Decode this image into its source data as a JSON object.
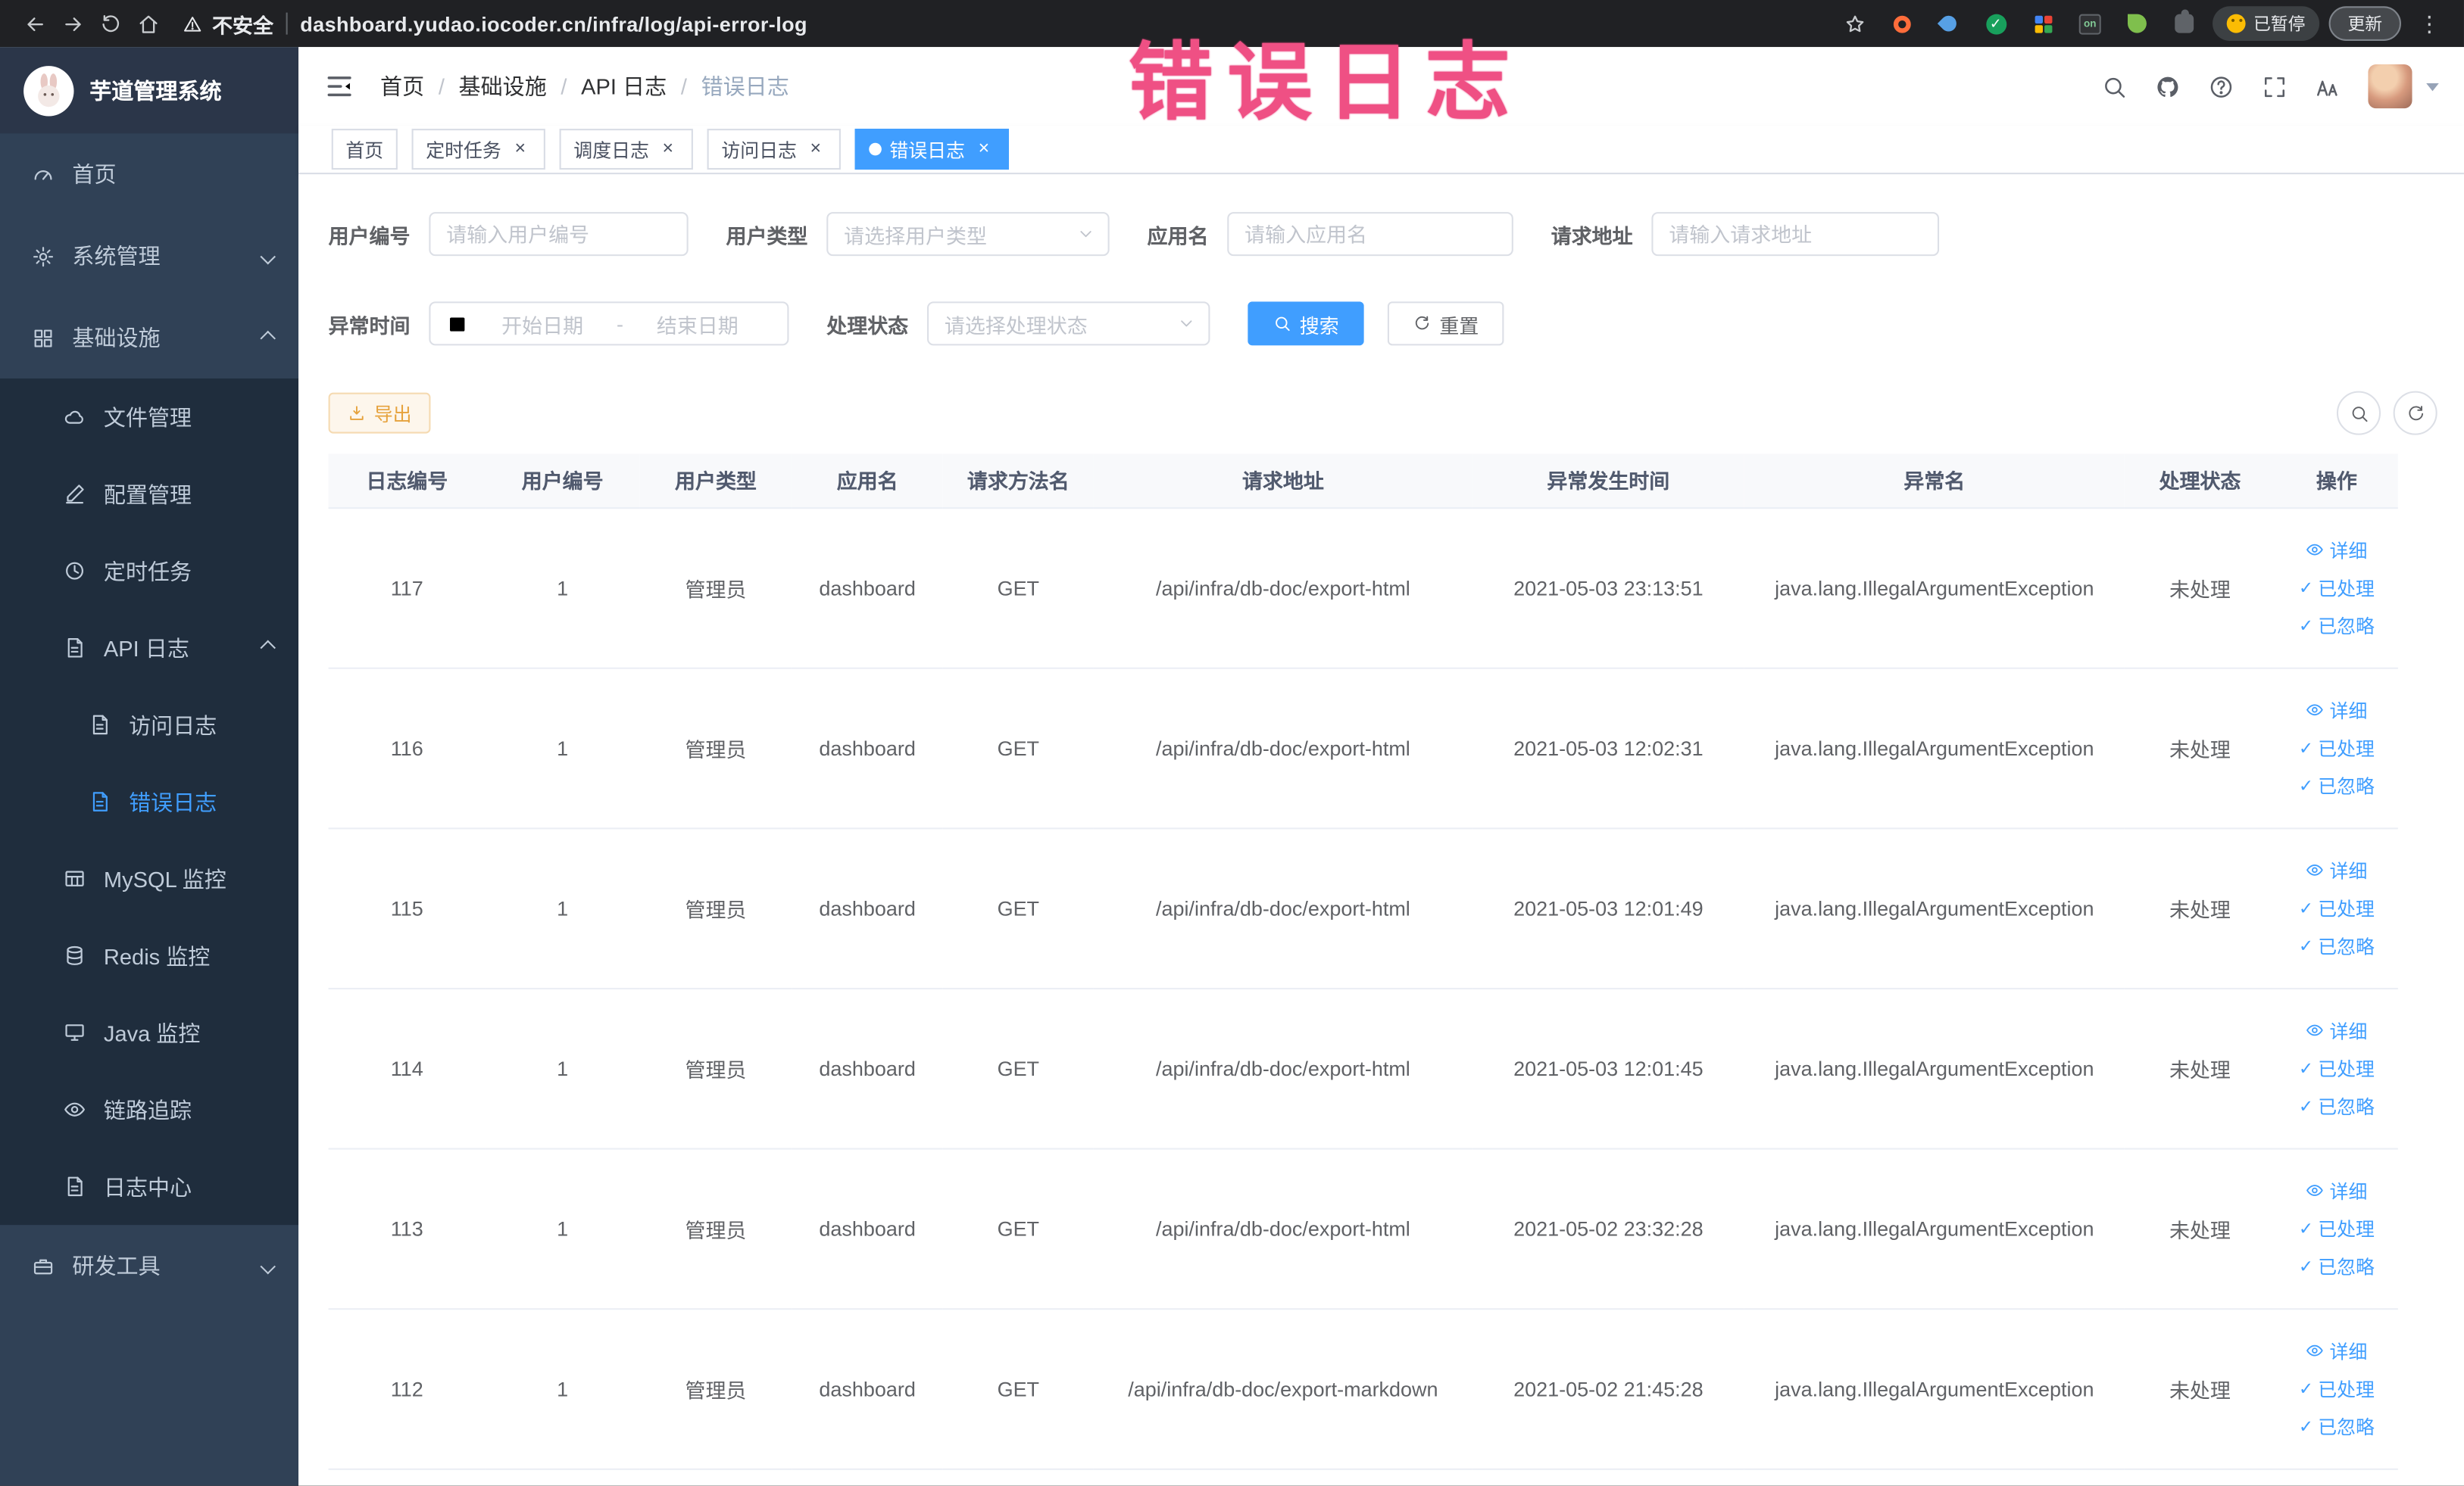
{
  "browser": {
    "security_label": "不安全",
    "url": "dashboard.yudao.iocoder.cn/infra/log/api-error-log",
    "paused_badge": "已暂停",
    "update_button": "更新"
  },
  "annotation": "错误日志",
  "sidebar": {
    "title": "芋道管理系统",
    "items": [
      {
        "label": "首页",
        "icon": "gauge-icon",
        "level": 1
      },
      {
        "label": "系统管理",
        "icon": "gear-icon",
        "level": 1,
        "expandable": true
      },
      {
        "label": "基础设施",
        "icon": "grid-icon",
        "level": 1,
        "expanded": true
      },
      {
        "label": "文件管理",
        "icon": "cloud-icon",
        "level": 2
      },
      {
        "label": "配置管理",
        "icon": "pencil-icon",
        "level": 2
      },
      {
        "label": "定时任务",
        "icon": "clock-icon",
        "level": 2
      },
      {
        "label": "API 日志",
        "icon": "doc-icon",
        "level": 2,
        "expanded": true
      },
      {
        "label": "访问日志",
        "icon": "doc-icon",
        "level": 3
      },
      {
        "label": "错误日志",
        "icon": "doc-icon",
        "level": 3,
        "active": true
      },
      {
        "label": "MySQL 监控",
        "icon": "table-icon",
        "level": 2
      },
      {
        "label": "Redis 监控",
        "icon": "database-icon",
        "level": 2
      },
      {
        "label": "Java 监控",
        "icon": "monitor-icon",
        "level": 2
      },
      {
        "label": "链路追踪",
        "icon": "eye-icon",
        "level": 2
      },
      {
        "label": "日志中心",
        "icon": "doc-icon",
        "level": 2
      },
      {
        "label": "研发工具",
        "icon": "toolbox-icon",
        "level": 1,
        "expandable": true
      }
    ]
  },
  "breadcrumb": [
    "首页",
    "基础设施",
    "API 日志",
    "错误日志"
  ],
  "tabs": [
    {
      "label": "首页",
      "closable": false,
      "active": false
    },
    {
      "label": "定时任务",
      "closable": true,
      "active": false
    },
    {
      "label": "调度日志",
      "closable": true,
      "active": false
    },
    {
      "label": "访问日志",
      "closable": true,
      "active": false
    },
    {
      "label": "错误日志",
      "closable": true,
      "active": true
    }
  ],
  "filters": {
    "user_id": {
      "label": "用户编号",
      "placeholder": "请输入用户编号"
    },
    "user_type": {
      "label": "用户类型",
      "placeholder": "请选择用户类型"
    },
    "app_name": {
      "label": "应用名",
      "placeholder": "请输入应用名"
    },
    "request_url": {
      "label": "请求地址",
      "placeholder": "请输入请求地址"
    },
    "exception_time": {
      "label": "异常时间",
      "start_placeholder": "开始日期",
      "separator": "-",
      "end_placeholder": "结束日期"
    },
    "process_status": {
      "label": "处理状态",
      "placeholder": "请选择处理状态"
    },
    "search_button": "搜索",
    "reset_button": "重置"
  },
  "toolbar": {
    "export_button": "导出"
  },
  "table": {
    "columns": [
      "日志编号",
      "用户编号",
      "用户类型",
      "应用名",
      "请求方法名",
      "请求地址",
      "异常发生时间",
      "异常名",
      "处理状态",
      "操作"
    ],
    "actions": {
      "detail": "详细",
      "processed": "已处理",
      "ignored": "已忽略"
    },
    "rows": [
      {
        "id": "117",
        "user_id": "1",
        "user_type": "管理员",
        "app": "dashboard",
        "method": "GET",
        "url": "/api/infra/db-doc/export-html",
        "time": "2021-05-03 23:13:51",
        "exception": "java.lang.IllegalArgumentException",
        "status": "未处理"
      },
      {
        "id": "116",
        "user_id": "1",
        "user_type": "管理员",
        "app": "dashboard",
        "method": "GET",
        "url": "/api/infra/db-doc/export-html",
        "time": "2021-05-03 12:02:31",
        "exception": "java.lang.IllegalArgumentException",
        "status": "未处理"
      },
      {
        "id": "115",
        "user_id": "1",
        "user_type": "管理员",
        "app": "dashboard",
        "method": "GET",
        "url": "/api/infra/db-doc/export-html",
        "time": "2021-05-03 12:01:49",
        "exception": "java.lang.IllegalArgumentException",
        "status": "未处理"
      },
      {
        "id": "114",
        "user_id": "1",
        "user_type": "管理员",
        "app": "dashboard",
        "method": "GET",
        "url": "/api/infra/db-doc/export-html",
        "time": "2021-05-03 12:01:45",
        "exception": "java.lang.IllegalArgumentException",
        "status": "未处理"
      },
      {
        "id": "113",
        "user_id": "1",
        "user_type": "管理员",
        "app": "dashboard",
        "method": "GET",
        "url": "/api/infra/db-doc/export-html",
        "time": "2021-05-02 23:32:28",
        "exception": "java.lang.IllegalArgumentException",
        "status": "未处理"
      },
      {
        "id": "112",
        "user_id": "1",
        "user_type": "管理员",
        "app": "dashboard",
        "method": "GET",
        "url": "/api/infra/db-doc/export-markdown",
        "time": "2021-05-02 21:45:28",
        "exception": "java.lang.IllegalArgumentException",
        "status": "未处理"
      }
    ]
  },
  "colors": {
    "primary": "#409EFF",
    "sidebar_bg": "#304156",
    "submenu_bg": "#1f2d3d",
    "warning_text": "#e6a23c",
    "annotation_pink": "#ef5084"
  }
}
